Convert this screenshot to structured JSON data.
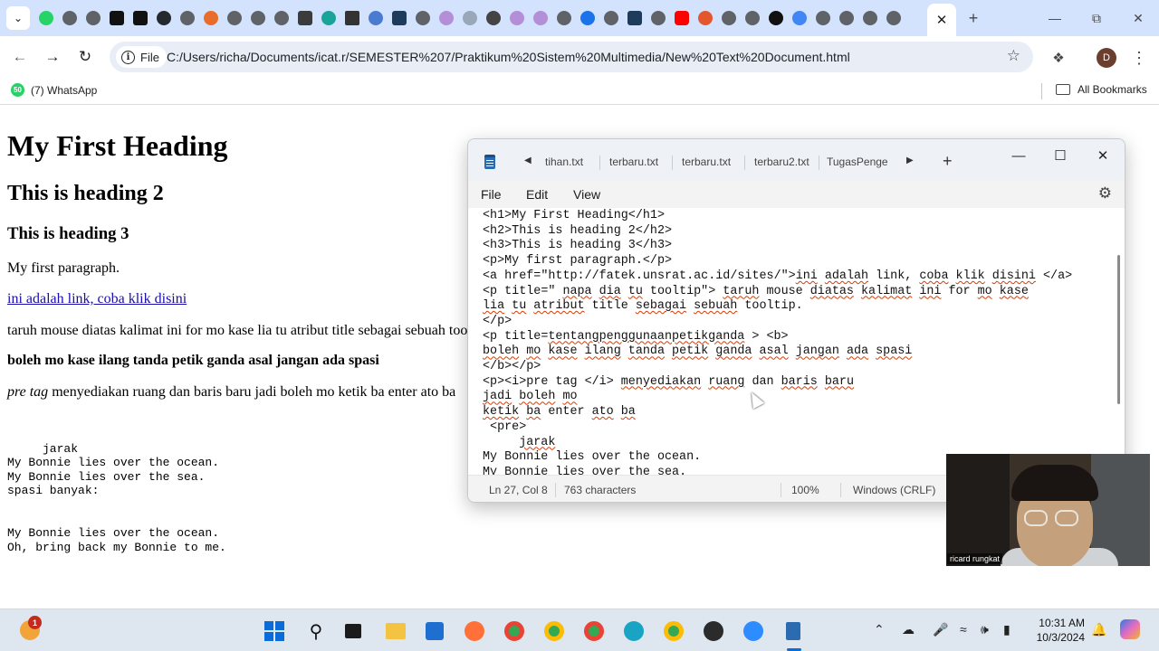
{
  "browser": {
    "address_scheme": "File",
    "url": "C:/Users/richa/Documents/icat.r/SEMESTER%207/Praktikum%20Sistem%20Multimedia/New%20Text%20Document.html",
    "avatar_letter": "D",
    "bookmarks": {
      "whatsapp_badge": "50",
      "whatsapp_label": "(7) WhatsApp",
      "all_bookmarks_label": "All Bookmarks"
    }
  },
  "page": {
    "h1": "My First Heading",
    "h2": "This is heading 2",
    "h3": "This is heading 3",
    "p1": "My first paragraph.",
    "link": "ini adalah link, coba klik disini",
    "p2": "taruh mouse diatas kalimat ini for mo kase lia tu atribut title sebagai sebuah tooltip.",
    "p3_bold": "boleh mo kase ilang tanda petik ganda asal jangan ada spasi",
    "p4_italic": "pre tag",
    "p4_rest": " menyediakan ruang dan baris baru jadi boleh mo ketik ba enter ato ba",
    "pre": "\n     jarak\nMy Bonnie lies over the ocean.\nMy Bonnie lies over the sea.\nspasi banyak:\n\n\nMy Bonnie lies over the ocean.\nOh, bring back my Bonnie to me."
  },
  "notepad": {
    "tabs": [
      "tihan.txt",
      "terbaru.txt",
      "terbaru.txt",
      "terbaru2.txt",
      "TugasPenge"
    ],
    "menu": [
      "File",
      "Edit",
      "View"
    ],
    "code_lines": [
      "<h1>My First Heading</h1>",
      "<h2>This is heading 2</h2>",
      "<h3>This is heading 3</h3>",
      "<p>My first paragraph.</p>",
      "<a href=\"http://fatek.unsrat.ac.id/sites/\">ini adalah link, coba klik disini </a>",
      "<p title=\" napa dia tu tooltip\"> taruh mouse diatas kalimat ini for mo kase",
      "lia tu atribut title sebagai sebuah tooltip.",
      "</p>",
      "<p title=tentangpenggunaanpetikganda > <b>",
      "boleh mo kase ilang tanda petik ganda asal jangan ada spasi",
      "</b></p>",
      "<p><i>pre tag </i> menyediakan ruang dan baris baru",
      "jadi boleh mo",
      "ketik ba enter ato ba",
      " <pre>",
      "     jarak",
      "My Bonnie lies over the ocean.",
      "My Bonnie lies over the sea."
    ],
    "status": {
      "position": "Ln 27, Col 8",
      "characters": "763 characters",
      "zoom": "100%",
      "line_ending": "Windows (CRLF)"
    }
  },
  "webcam": {
    "name": "ricard rungkat"
  },
  "taskbar": {
    "weather_badge": "1",
    "time": "10:31 AM",
    "date": "10/3/2024"
  },
  "colors": {
    "tabstrip": "#d3e3fd",
    "link": "#1a0dab",
    "taskbar": "#dee6ef",
    "accent": "#0a6cd9"
  }
}
